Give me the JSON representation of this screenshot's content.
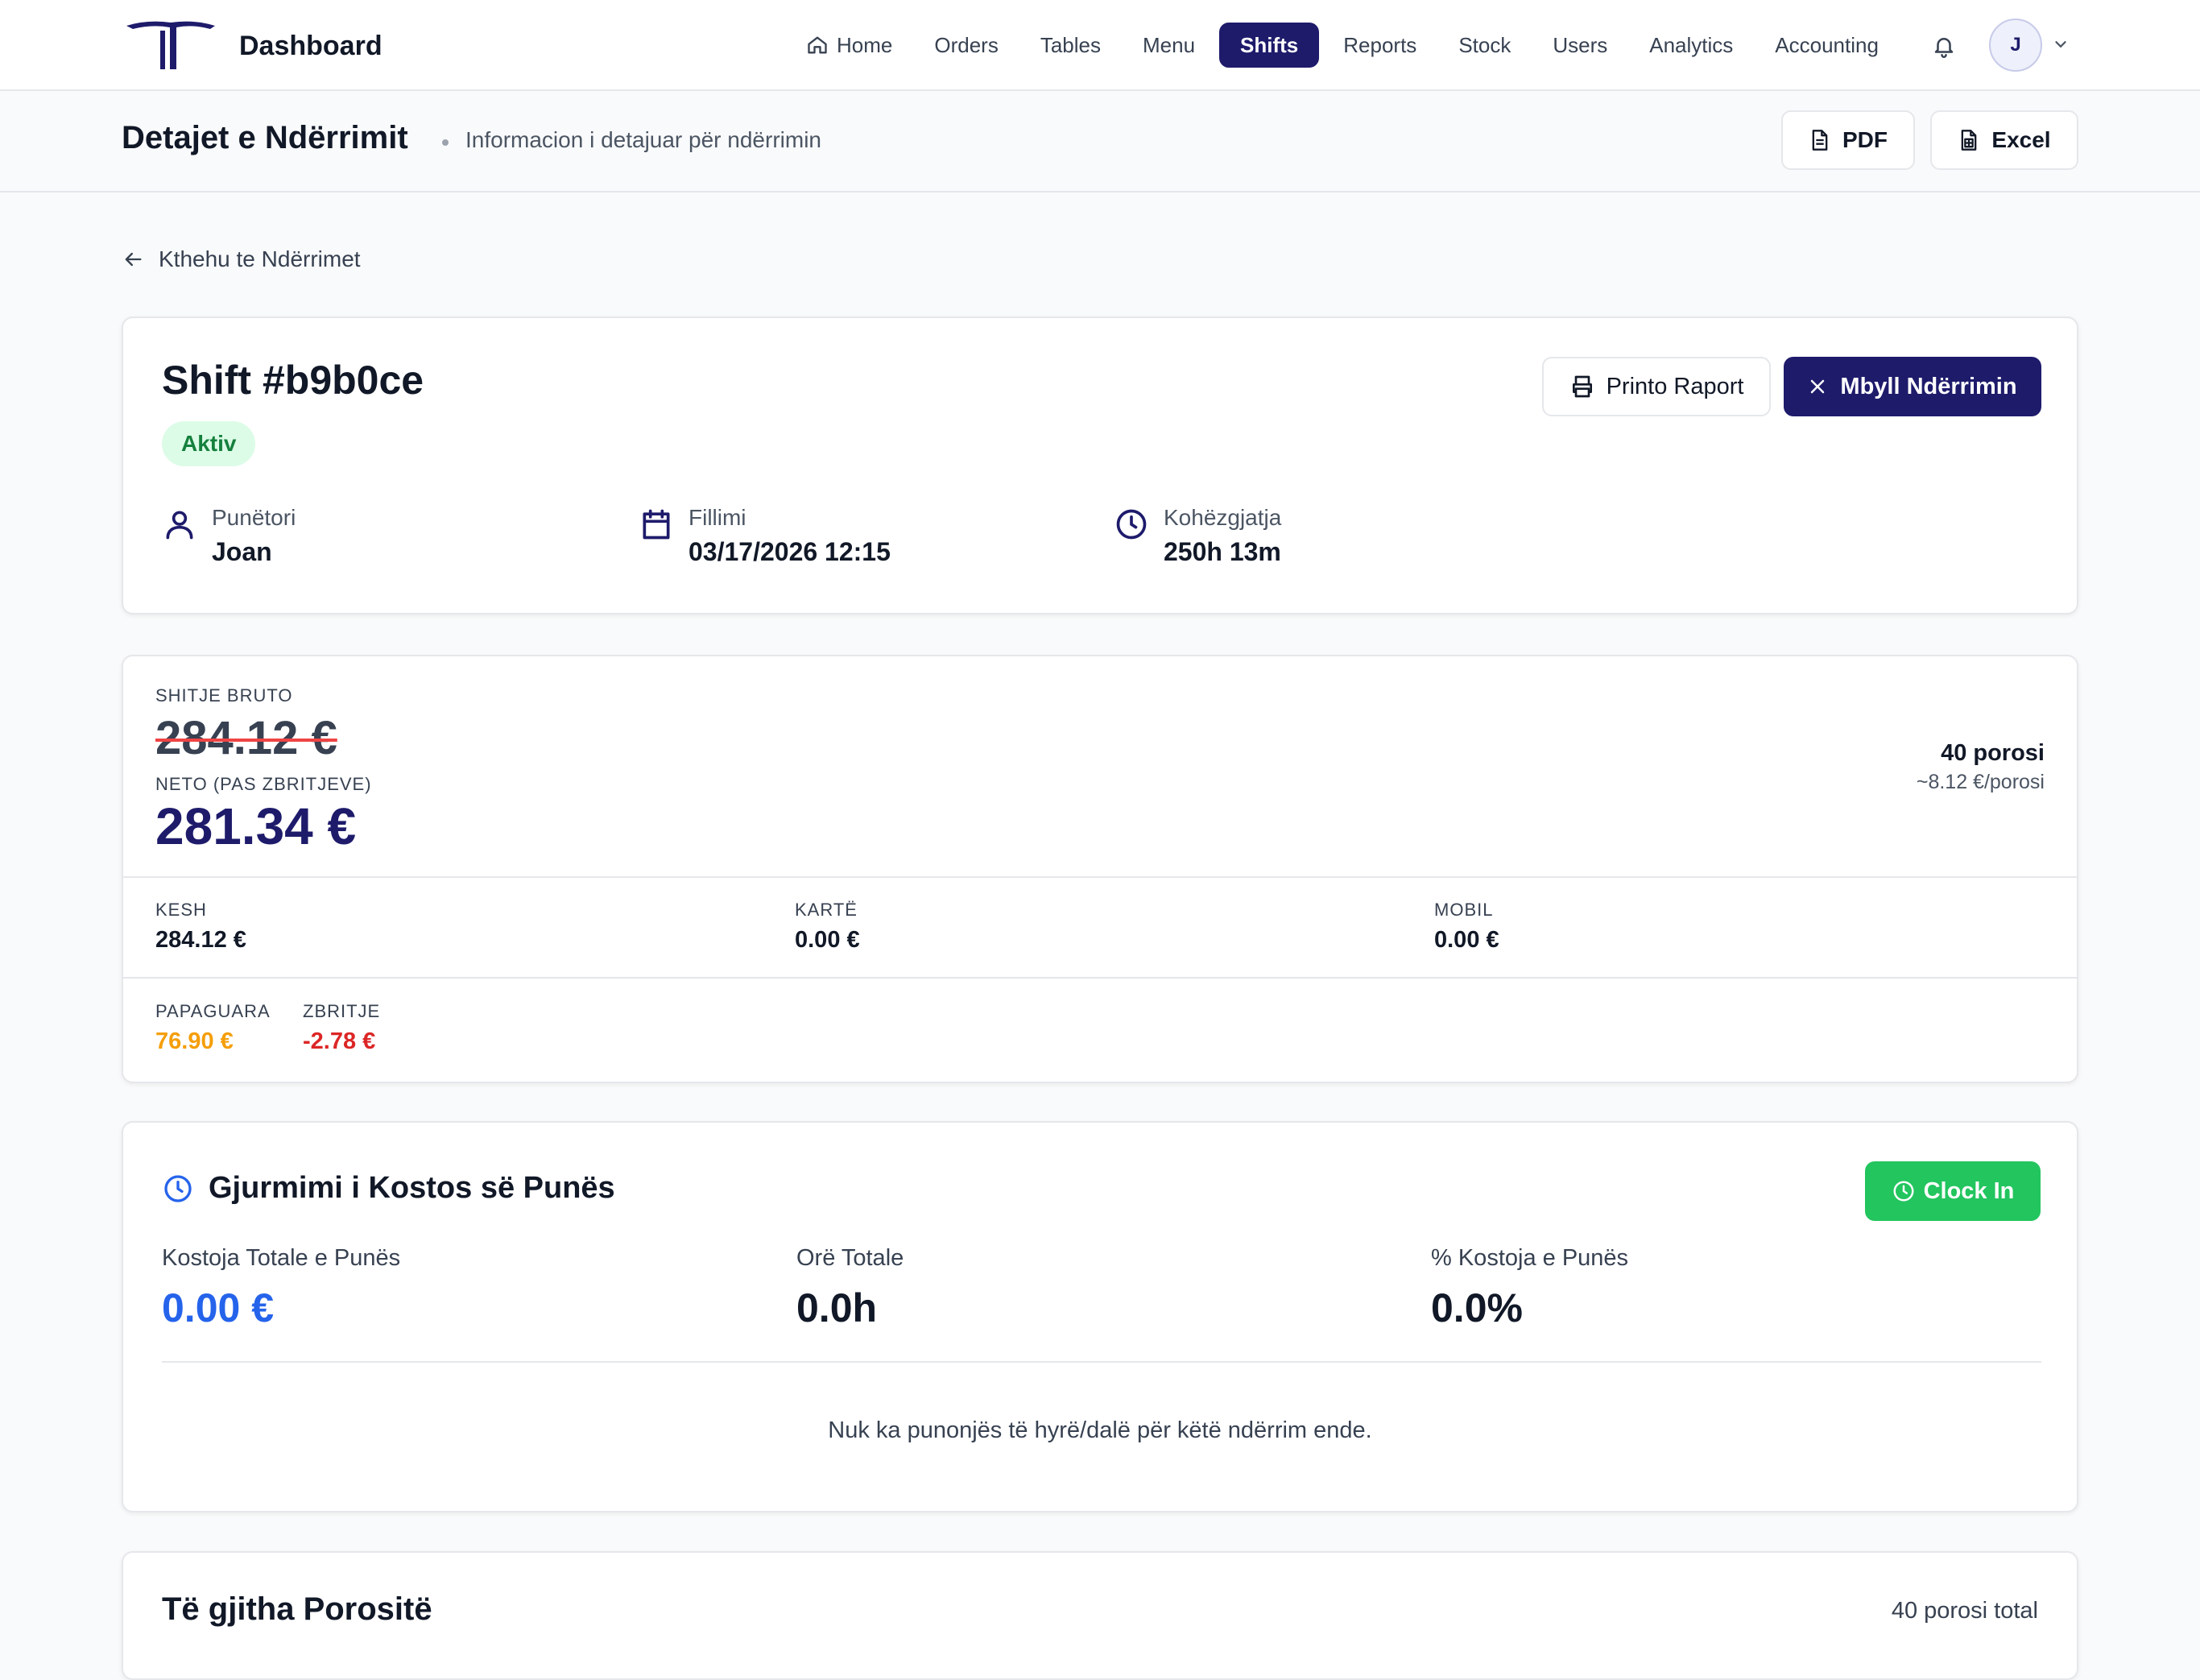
{
  "app": {
    "title": "Dashboard",
    "brand_color": "#1e1b6b"
  },
  "nav": {
    "items": [
      {
        "label": "Home",
        "icon": "home-icon"
      },
      {
        "label": "Orders"
      },
      {
        "label": "Tables"
      },
      {
        "label": "Menu"
      },
      {
        "label": "Shifts",
        "active": true
      },
      {
        "label": "Reports"
      },
      {
        "label": "Stock"
      },
      {
        "label": "Users"
      },
      {
        "label": "Analytics"
      },
      {
        "label": "Accounting"
      }
    ],
    "user_initial": "J"
  },
  "header": {
    "title": "Detajet e Ndërrimit",
    "subtitle": "Informacion i detajuar për ndërrimin",
    "pdf_label": "PDF",
    "excel_label": "Excel"
  },
  "back_label": "Kthehu te Ndërrimet",
  "shift": {
    "title": "Shift #b9b0ce",
    "status": "Aktiv",
    "print_label": "Printo Raport",
    "close_label": "Mbyll Ndërrimin",
    "worker_label": "Punëtori",
    "worker": "Joan",
    "start_label": "Fillimi",
    "start": "03/17/2026 12:15",
    "duration_label": "Kohëzgjatja",
    "duration": "250h 13m"
  },
  "sales": {
    "gross_label": "Shitje Bruto",
    "gross": "284.12 €",
    "net_label": "Neto (pas zbritjeve)",
    "net": "281.34 €",
    "orders_count": "40 porosi",
    "orders_avg": "~8.12 €/porosi",
    "cash_label": "Kesh",
    "cash": "284.12 €",
    "card_label": "Kartë",
    "card": "0.00 €",
    "mobile_label": "Mobil",
    "mobile": "0.00 €",
    "unpaid_label": "Papaguara",
    "unpaid": "76.90 €",
    "discount_label": "Zbritje",
    "discount": "-2.78 €"
  },
  "labor": {
    "title": "Gjurmimi i Kostos së Punës",
    "clock_in_label": "Clock In",
    "total_cost_label": "Kostoja Totale e Punës",
    "total_cost": "0.00 €",
    "total_hours_label": "Orë Totale",
    "total_hours": "0.0h",
    "cost_pct_label": "% Kostoja e Punës",
    "cost_pct": "0.0%",
    "empty_message": "Nuk ka punonjës të hyrë/dalë për këtë ndërrim ende."
  },
  "orders": {
    "title": "Të gjitha Porositë",
    "total": "40 porosi total"
  }
}
